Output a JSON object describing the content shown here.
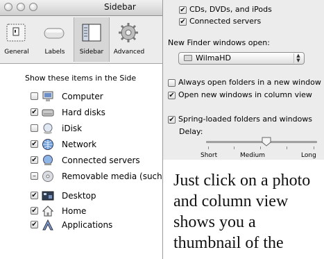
{
  "window": {
    "title": "Sidebar"
  },
  "toolbar": {
    "items": [
      {
        "label": "General",
        "icon": "general-icon",
        "selected": false
      },
      {
        "label": "Labels",
        "icon": "labels-icon",
        "selected": false
      },
      {
        "label": "Sidebar",
        "icon": "sidebar-icon",
        "selected": true
      },
      {
        "label": "Advanced",
        "icon": "gear-icon",
        "selected": false
      }
    ]
  },
  "sidebar_prefs": {
    "heading": "Show these items in the Side",
    "items": [
      {
        "label": "Computer",
        "state": "unchecked",
        "icon": "computer-icon"
      },
      {
        "label": "Hard disks",
        "state": "checked",
        "icon": "hard-disk-icon"
      },
      {
        "label": "iDisk",
        "state": "unchecked",
        "icon": "idisk-icon"
      },
      {
        "label": "Network",
        "state": "checked",
        "icon": "network-icon"
      },
      {
        "label": "Connected servers",
        "state": "checked",
        "icon": "server-icon"
      },
      {
        "label": "Removable media (such a",
        "state": "mixed",
        "icon": "removable-media-icon"
      },
      {
        "label": "Desktop",
        "state": "checked",
        "icon": "desktop-icon"
      },
      {
        "label": "Home",
        "state": "checked",
        "icon": "home-icon"
      },
      {
        "label": "Applications",
        "state": "checked",
        "icon": "applications-icon"
      }
    ]
  },
  "general_prefs": {
    "show_cds": "CDs, DVDs, and iPods",
    "show_servers": "Connected servers",
    "new_window_label": "New Finder windows open:",
    "new_window_value": "WilmaHD",
    "always_open_new": "Always open folders in a new window",
    "column_view": "Open new windows in column view",
    "spring_loaded": "Spring-loaded folders and windows",
    "delay_label": "Delay:",
    "scale": [
      "Short",
      "Medium",
      "Long"
    ],
    "delay_level": 0.55
  },
  "caption": {
    "lines": [
      "Just click on a photo",
      "and column view",
      "shows you a",
      "thumbnail of the"
    ]
  },
  "colors": {
    "checkmark": "#111111",
    "accent": "#3a78d8"
  }
}
